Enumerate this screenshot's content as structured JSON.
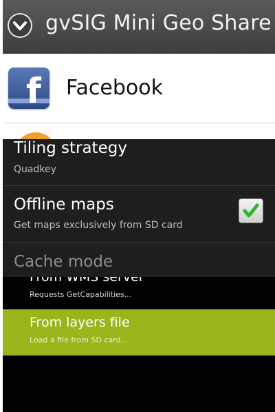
{
  "share_dialog": {
    "title": "gvSIG Mini Geo Share",
    "icon": "chevron-down-icon",
    "items": [
      {
        "label": "Facebook",
        "icon": "facebook-icon"
      }
    ]
  },
  "settings": {
    "tiling_strategy": {
      "title": "Tiling strategy",
      "summary": "Quadkey"
    },
    "offline_maps": {
      "title": "Offline maps",
      "summary": "Get maps exclusively from SD card",
      "checked": true
    },
    "cache_mode": {
      "title": "Cache mode"
    }
  },
  "cache_options": {
    "wms": {
      "title": "From WMS server",
      "summary": "Requests GetCapabilities..."
    },
    "layers_file": {
      "title": "From layers file",
      "summary": "Load a file from SD card...",
      "selected": true
    }
  },
  "colors": {
    "selected_highlight": "#98b51c",
    "check": "#2db72d"
  }
}
